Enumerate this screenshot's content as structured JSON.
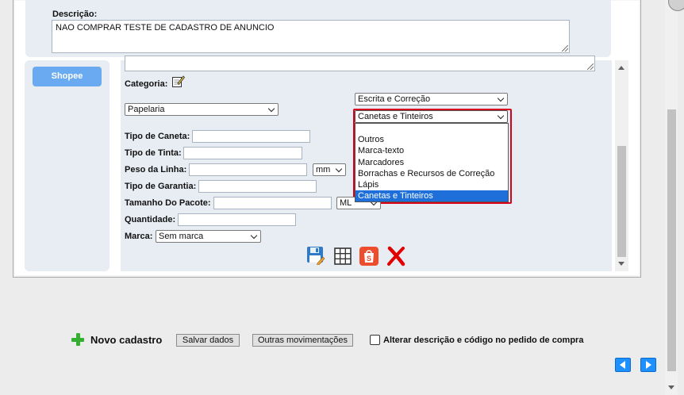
{
  "description": {
    "label": "Descrição:",
    "value": "NAO COMPRAR TESTE DE CADASTRO DE ANUNCIO"
  },
  "marketplace_tab": {
    "label": "Shopee"
  },
  "form": {
    "categoria_label": "Categoria:",
    "category_level1": "Papelaria",
    "category_level2": "Escrita e Correção",
    "category_level3": "Canetas e Tinteiros",
    "category_options": [
      "",
      "Outros",
      "Marca-texto",
      "Marcadores",
      "Borrachas e Recursos de Correção",
      "Lápis",
      "Canetas e Tinteiros"
    ],
    "fields": {
      "tipo_caneta": {
        "label": "Tipo de Caneta:",
        "value": ""
      },
      "tipo_tinta": {
        "label": "Tipo de Tinta:",
        "value": ""
      },
      "peso_linha": {
        "label": "Peso da Linha:",
        "value": "",
        "unit": "mm"
      },
      "tipo_garantia": {
        "label": "Tipo de Garantia:",
        "value": ""
      },
      "tamanho_pacote": {
        "label": "Tamanho Do Pacote:",
        "value": "",
        "unit": "ML"
      },
      "quantidade": {
        "label": "Quantidade:",
        "value": ""
      },
      "marca": {
        "label": "Marca:",
        "value": "Sem marca"
      }
    },
    "action_icons": [
      "save-icon",
      "table-icon",
      "shopee-bag-icon",
      "delete-x-icon"
    ],
    "colors": {
      "shopee": "#ee4d2d",
      "delete": "#e00000",
      "highlight": "#d9001b",
      "selected_option": "#1e6fd9"
    }
  },
  "footer": {
    "novo_cadastro": "Novo cadastro",
    "salvar": "Salvar dados",
    "outras": "Outras movimentações",
    "checkbox_label": "Alterar descrição e código no pedido de compra",
    "checkbox_checked": false
  }
}
